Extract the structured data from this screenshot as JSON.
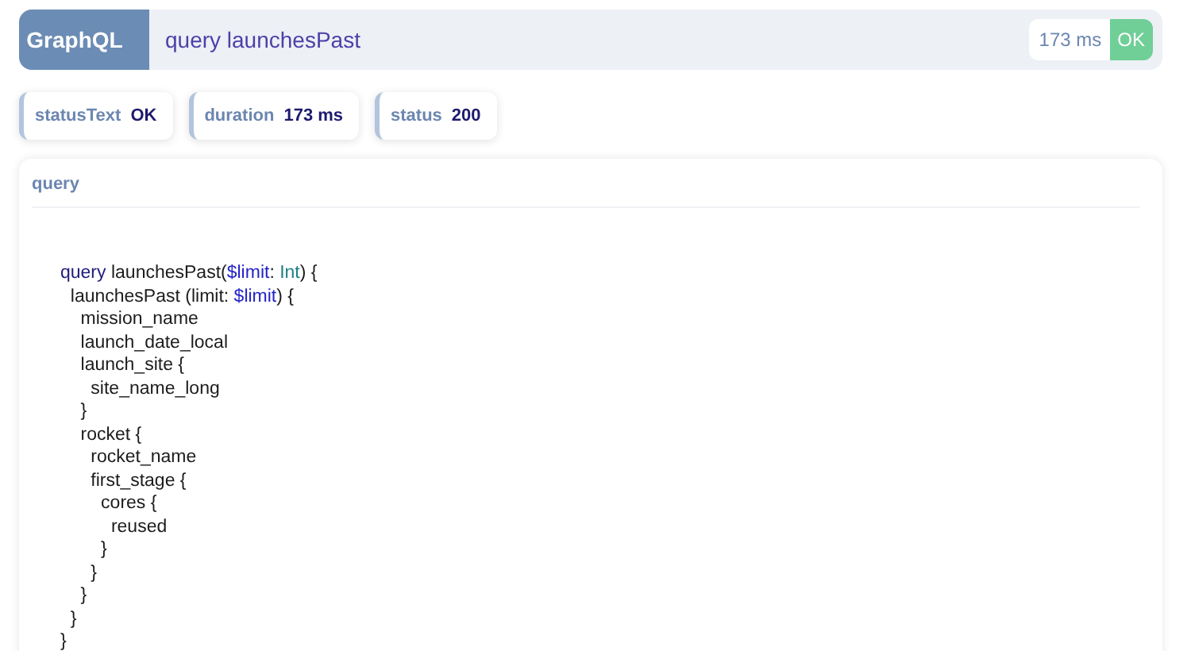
{
  "header": {
    "badge": "GraphQL",
    "operation": "query launchesPast",
    "duration": "173 ms",
    "status": "OK"
  },
  "chips": [
    {
      "label": "statusText",
      "value": "OK"
    },
    {
      "label": "duration",
      "value": "173 ms"
    },
    {
      "label": "status",
      "value": "200"
    }
  ],
  "panel": {
    "title": "query",
    "code_lines": [
      [
        {
          "kind": "keyword",
          "text": "query"
        },
        {
          "kind": "plain",
          "text": " launchesPast("
        },
        {
          "kind": "variable",
          "text": "$limit"
        },
        {
          "kind": "plain",
          "text": ": "
        },
        {
          "kind": "type",
          "text": "Int"
        },
        {
          "kind": "plain",
          "text": ") {"
        }
      ],
      [
        {
          "kind": "plain",
          "text": "  launchesPast (limit: "
        },
        {
          "kind": "variable",
          "text": "$limit"
        },
        {
          "kind": "plain",
          "text": ") {"
        }
      ],
      [
        {
          "kind": "plain",
          "text": "    mission_name"
        }
      ],
      [
        {
          "kind": "plain",
          "text": "    launch_date_local"
        }
      ],
      [
        {
          "kind": "plain",
          "text": "    launch_site {"
        }
      ],
      [
        {
          "kind": "plain",
          "text": "      site_name_long"
        }
      ],
      [
        {
          "kind": "plain",
          "text": "    }"
        }
      ],
      [
        {
          "kind": "plain",
          "text": "    rocket {"
        }
      ],
      [
        {
          "kind": "plain",
          "text": "      rocket_name"
        }
      ],
      [
        {
          "kind": "plain",
          "text": "      first_stage {"
        }
      ],
      [
        {
          "kind": "plain",
          "text": "        cores {"
        }
      ],
      [
        {
          "kind": "plain",
          "text": "          reused"
        }
      ],
      [
        {
          "kind": "plain",
          "text": "        }"
        }
      ],
      [
        {
          "kind": "plain",
          "text": "      }"
        }
      ],
      [
        {
          "kind": "plain",
          "text": "    }"
        }
      ],
      [
        {
          "kind": "plain",
          "text": "  }"
        }
      ],
      [
        {
          "kind": "plain",
          "text": "}"
        }
      ]
    ]
  }
}
